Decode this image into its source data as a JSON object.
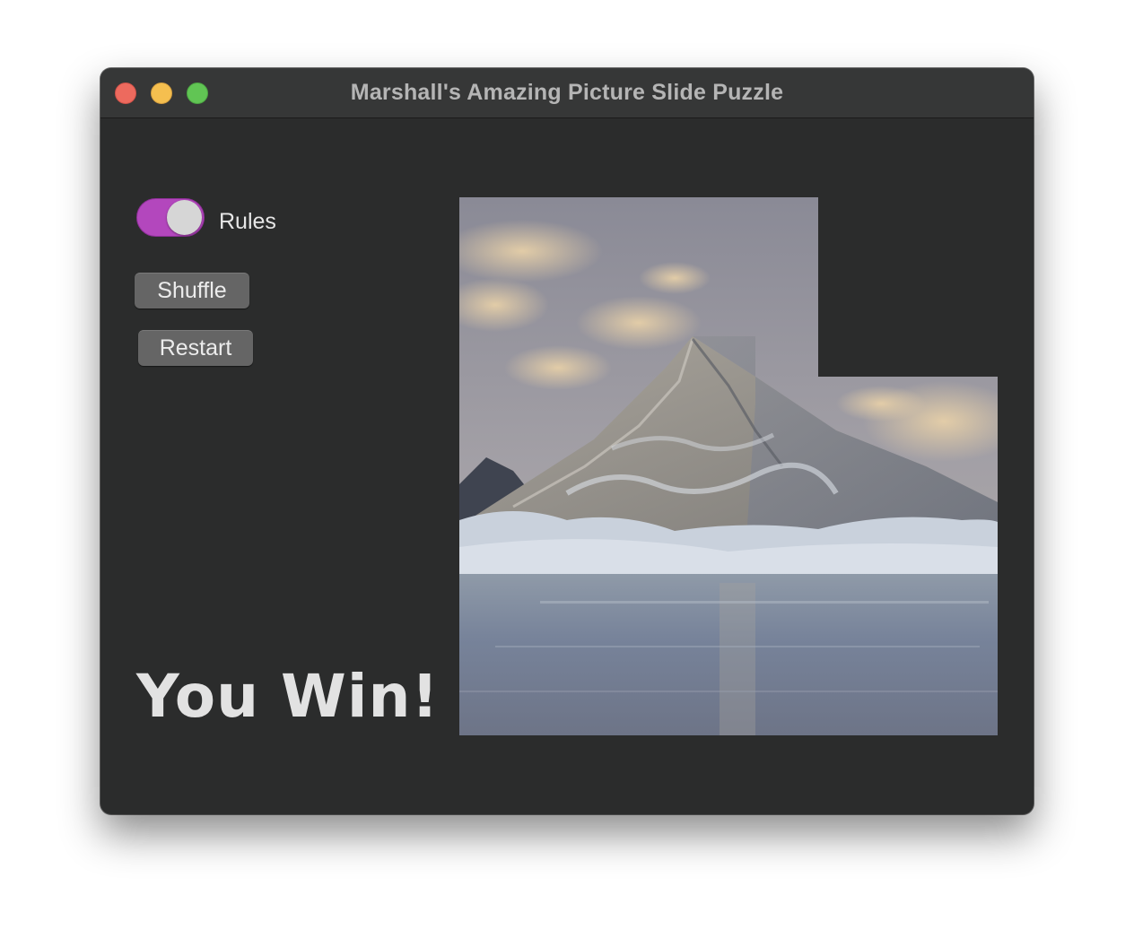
{
  "window": {
    "title": "Marshall's Amazing Picture Slide Puzzle"
  },
  "controls": {
    "rules_label": "Rules",
    "rules_toggle_on": true,
    "shuffle_label": "Shuffle",
    "restart_label": "Restart"
  },
  "status": {
    "message": "You Win!"
  },
  "puzzle": {
    "grid_size": 3,
    "empty_tile": "top-right",
    "image_subject": "snowy mountain peak above a reflective lake under a cloudy sky"
  },
  "colors": {
    "window_bg": "#2b2c2c",
    "titlebar_bg": "#363737",
    "toggle_accent": "#b347bd",
    "button_bg": "#656565"
  }
}
